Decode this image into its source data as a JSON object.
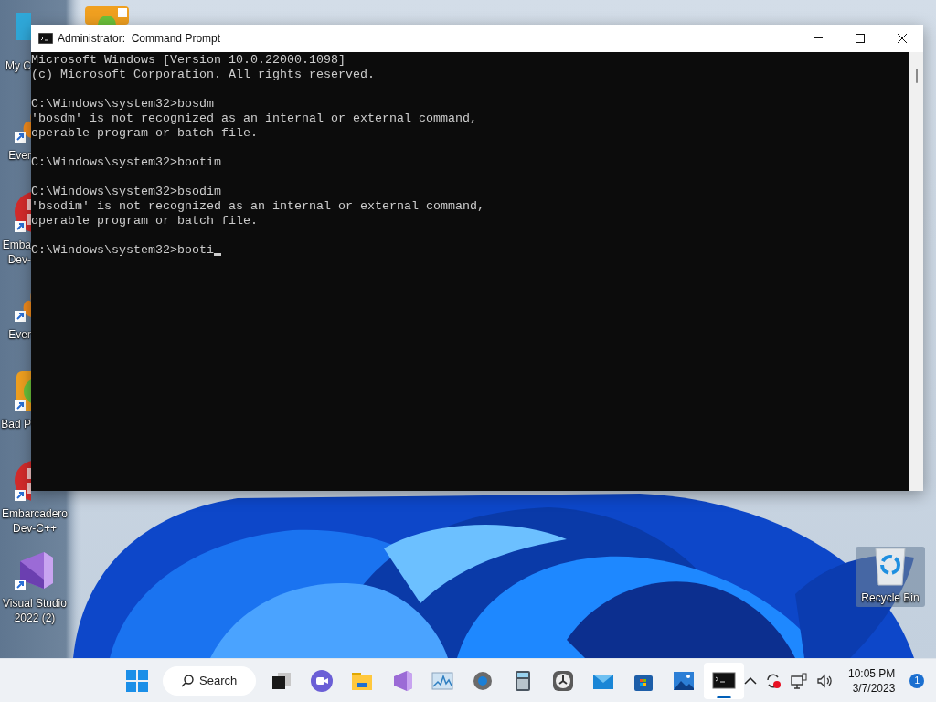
{
  "desktop_icons": [
    {
      "label": [
        "My C"
      ]
    },
    {
      "label": [
        "Ever"
      ]
    },
    {
      "label": [
        "Emba",
        "Dev-"
      ]
    },
    {
      "label": [
        "Ever"
      ]
    },
    {
      "label": [
        "Bad P"
      ]
    },
    {
      "label": [
        "Embarcadero",
        "Dev-C++"
      ]
    },
    {
      "label": [
        "Visual Studio",
        "2022 (2)"
      ]
    }
  ],
  "recycle_bin": {
    "label": "Recycle Bin"
  },
  "window": {
    "title": "Administrator:  Command Prompt",
    "cursor": true,
    "console_blocks": [
      [
        "Microsoft Windows [Version 10.0.22000.1098]",
        "(c) Microsoft Corporation. All rights reserved."
      ],
      [
        "C:\\Windows\\system32>bosdm",
        "'bosdm' is not recognized as an internal or external command,",
        "operable program or batch file."
      ],
      [
        "C:\\Windows\\system32>bootim"
      ],
      [
        "C:\\Windows\\system32>bsodim",
        "'bsodim' is not recognized as an internal or external command,",
        "operable program or batch file."
      ],
      [
        "C:\\Windows\\system32>booti"
      ]
    ]
  },
  "taskbar": {
    "search": "Search",
    "apps": [
      {
        "selected": false
      },
      {
        "selected": false
      },
      {
        "selected": false
      },
      {
        "selected": false
      },
      {
        "selected": false
      },
      {
        "selected": false
      },
      {
        "selected": false
      },
      {
        "selected": false
      },
      {
        "selected": false
      },
      {
        "selected": false
      },
      {
        "selected": false
      },
      {
        "selected": true
      }
    ],
    "time": "10:05 PM",
    "date": "3/7/2023",
    "notification_count": "1"
  }
}
